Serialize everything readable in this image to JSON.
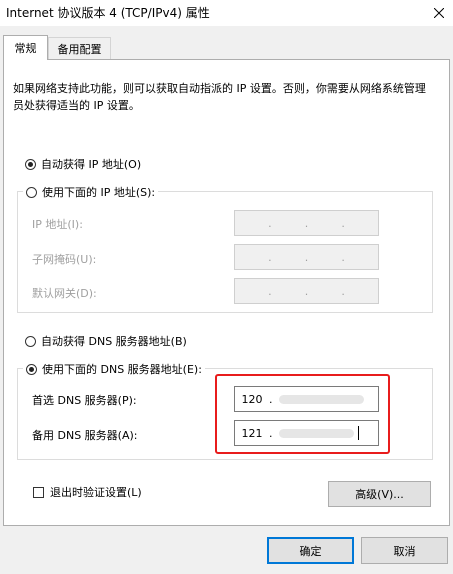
{
  "window": {
    "title": "Internet 协议版本 4 (TCP/IPv4) 属性",
    "close_icon": "close-icon"
  },
  "tabs": [
    {
      "label": "常规",
      "active": true
    },
    {
      "label": "备用配置",
      "active": false
    }
  ],
  "description": "如果网络支持此功能，则可以获取自动指派的 IP 设置。否则，你需要从网络系统管理员处获得适当的 IP 设置。",
  "ip": {
    "auto_label": "自动获得 IP 地址(O)",
    "auto_selected": true,
    "manual_label": "使用下面的 IP 地址(S):",
    "manual_selected": false,
    "fields": [
      {
        "label": "IP 地址(I):"
      },
      {
        "label": "子网掩码(U):"
      },
      {
        "label": "默认网关(D):"
      }
    ],
    "dot": "."
  },
  "dns": {
    "auto_label": "自动获得 DNS 服务器地址(B)",
    "auto_selected": false,
    "manual_label": "使用下面的 DNS 服务器地址(E):",
    "manual_selected": true,
    "preferred": {
      "label": "首选 DNS 服务器(P):",
      "first_octet": "120",
      "dot": "."
    },
    "alternate": {
      "label": "备用 DNS 服务器(A):",
      "first_octet": "121",
      "dot": "."
    }
  },
  "validate_label": "退出时验证设置(L)",
  "advanced_button": "高级(V)...",
  "ok_button": "确定",
  "cancel_button": "取消",
  "colors": {
    "highlight": "#e81c1c",
    "default_button_border": "#0078d7"
  }
}
